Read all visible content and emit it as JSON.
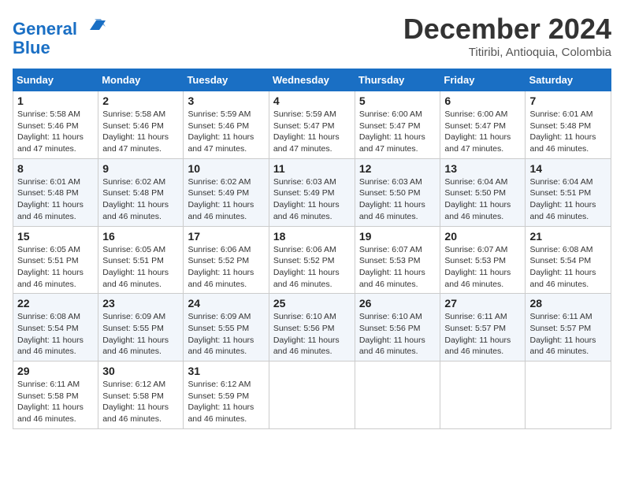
{
  "header": {
    "logo_line1": "General",
    "logo_line2": "Blue",
    "month_title": "December 2024",
    "location": "Titiribi, Antioquia, Colombia"
  },
  "weekdays": [
    "Sunday",
    "Monday",
    "Tuesday",
    "Wednesday",
    "Thursday",
    "Friday",
    "Saturday"
  ],
  "weeks": [
    [
      {
        "day": "1",
        "info": "Sunrise: 5:58 AM\nSunset: 5:46 PM\nDaylight: 11 hours\nand 47 minutes."
      },
      {
        "day": "2",
        "info": "Sunrise: 5:58 AM\nSunset: 5:46 PM\nDaylight: 11 hours\nand 47 minutes."
      },
      {
        "day": "3",
        "info": "Sunrise: 5:59 AM\nSunset: 5:46 PM\nDaylight: 11 hours\nand 47 minutes."
      },
      {
        "day": "4",
        "info": "Sunrise: 5:59 AM\nSunset: 5:47 PM\nDaylight: 11 hours\nand 47 minutes."
      },
      {
        "day": "5",
        "info": "Sunrise: 6:00 AM\nSunset: 5:47 PM\nDaylight: 11 hours\nand 47 minutes."
      },
      {
        "day": "6",
        "info": "Sunrise: 6:00 AM\nSunset: 5:47 PM\nDaylight: 11 hours\nand 47 minutes."
      },
      {
        "day": "7",
        "info": "Sunrise: 6:01 AM\nSunset: 5:48 PM\nDaylight: 11 hours\nand 46 minutes."
      }
    ],
    [
      {
        "day": "8",
        "info": "Sunrise: 6:01 AM\nSunset: 5:48 PM\nDaylight: 11 hours\nand 46 minutes."
      },
      {
        "day": "9",
        "info": "Sunrise: 6:02 AM\nSunset: 5:48 PM\nDaylight: 11 hours\nand 46 minutes."
      },
      {
        "day": "10",
        "info": "Sunrise: 6:02 AM\nSunset: 5:49 PM\nDaylight: 11 hours\nand 46 minutes."
      },
      {
        "day": "11",
        "info": "Sunrise: 6:03 AM\nSunset: 5:49 PM\nDaylight: 11 hours\nand 46 minutes."
      },
      {
        "day": "12",
        "info": "Sunrise: 6:03 AM\nSunset: 5:50 PM\nDaylight: 11 hours\nand 46 minutes."
      },
      {
        "day": "13",
        "info": "Sunrise: 6:04 AM\nSunset: 5:50 PM\nDaylight: 11 hours\nand 46 minutes."
      },
      {
        "day": "14",
        "info": "Sunrise: 6:04 AM\nSunset: 5:51 PM\nDaylight: 11 hours\nand 46 minutes."
      }
    ],
    [
      {
        "day": "15",
        "info": "Sunrise: 6:05 AM\nSunset: 5:51 PM\nDaylight: 11 hours\nand 46 minutes."
      },
      {
        "day": "16",
        "info": "Sunrise: 6:05 AM\nSunset: 5:51 PM\nDaylight: 11 hours\nand 46 minutes."
      },
      {
        "day": "17",
        "info": "Sunrise: 6:06 AM\nSunset: 5:52 PM\nDaylight: 11 hours\nand 46 minutes."
      },
      {
        "day": "18",
        "info": "Sunrise: 6:06 AM\nSunset: 5:52 PM\nDaylight: 11 hours\nand 46 minutes."
      },
      {
        "day": "19",
        "info": "Sunrise: 6:07 AM\nSunset: 5:53 PM\nDaylight: 11 hours\nand 46 minutes."
      },
      {
        "day": "20",
        "info": "Sunrise: 6:07 AM\nSunset: 5:53 PM\nDaylight: 11 hours\nand 46 minutes."
      },
      {
        "day": "21",
        "info": "Sunrise: 6:08 AM\nSunset: 5:54 PM\nDaylight: 11 hours\nand 46 minutes."
      }
    ],
    [
      {
        "day": "22",
        "info": "Sunrise: 6:08 AM\nSunset: 5:54 PM\nDaylight: 11 hours\nand 46 minutes."
      },
      {
        "day": "23",
        "info": "Sunrise: 6:09 AM\nSunset: 5:55 PM\nDaylight: 11 hours\nand 46 minutes."
      },
      {
        "day": "24",
        "info": "Sunrise: 6:09 AM\nSunset: 5:55 PM\nDaylight: 11 hours\nand 46 minutes."
      },
      {
        "day": "25",
        "info": "Sunrise: 6:10 AM\nSunset: 5:56 PM\nDaylight: 11 hours\nand 46 minutes."
      },
      {
        "day": "26",
        "info": "Sunrise: 6:10 AM\nSunset: 5:56 PM\nDaylight: 11 hours\nand 46 minutes."
      },
      {
        "day": "27",
        "info": "Sunrise: 6:11 AM\nSunset: 5:57 PM\nDaylight: 11 hours\nand 46 minutes."
      },
      {
        "day": "28",
        "info": "Sunrise: 6:11 AM\nSunset: 5:57 PM\nDaylight: 11 hours\nand 46 minutes."
      }
    ],
    [
      {
        "day": "29",
        "info": "Sunrise: 6:11 AM\nSunset: 5:58 PM\nDaylight: 11 hours\nand 46 minutes."
      },
      {
        "day": "30",
        "info": "Sunrise: 6:12 AM\nSunset: 5:58 PM\nDaylight: 11 hours\nand 46 minutes."
      },
      {
        "day": "31",
        "info": "Sunrise: 6:12 AM\nSunset: 5:59 PM\nDaylight: 11 hours\nand 46 minutes."
      },
      null,
      null,
      null,
      null
    ]
  ]
}
